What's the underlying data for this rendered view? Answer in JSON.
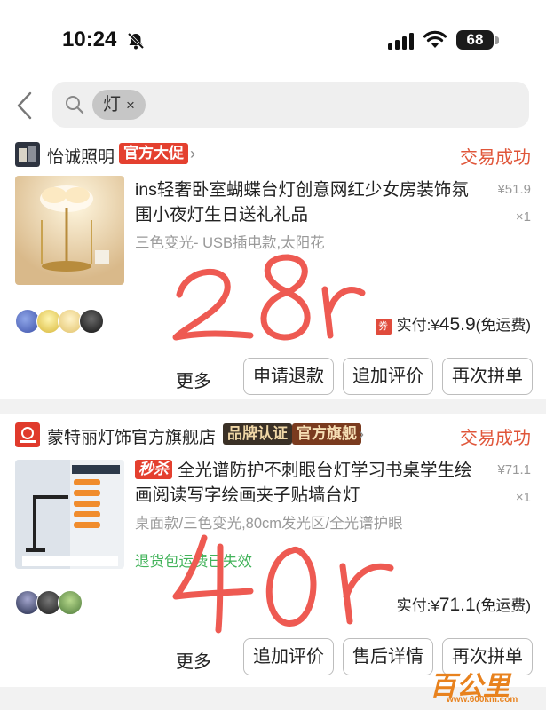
{
  "status_bar": {
    "time": "10:24",
    "battery": "68"
  },
  "search": {
    "chip": "灯",
    "chip_close": "×"
  },
  "orders": [
    {
      "shop_name": "怡诚照明",
      "badges": [
        "官方大促"
      ],
      "status": "交易成功",
      "title": "ins轻奢卧室蝴蝶台灯创意网红少女房装饰氛围小夜灯生日送礼礼品",
      "price": "¥51.9",
      "qty": "×1",
      "sku": "三色变光- USB插电款,太阳花",
      "paid_label": "实付:",
      "paid_currency": "¥",
      "paid_amount": "45.9",
      "shipping": "(免运费)",
      "coupon_icon": "券",
      "more": "更多",
      "buttons": [
        "申请退款",
        "追加评价",
        "再次拼单"
      ],
      "handwritten": "28r"
    },
    {
      "shop_name": "蒙特丽灯饰官方旗舰店",
      "badges": [
        "品牌认证",
        "官方旗舰"
      ],
      "status": "交易成功",
      "tag": "秒杀",
      "title": "全光谱防护不刺眼台灯学习书桌学生绘画阅读写字绘画夹子贴墙台灯",
      "price": "¥71.1",
      "qty": "×1",
      "sku": "桌面款/三色变光,80cm发光区/全光谱护眼",
      "return_note": "退货包运费已失效",
      "paid_label": "实付:",
      "paid_currency": "¥",
      "paid_amount": "71.1",
      "shipping": "(免运费)",
      "more": "更多",
      "buttons": [
        "追加评价",
        "售后详情",
        "再次拼单"
      ],
      "handwritten": "40r"
    }
  ],
  "watermark": {
    "text": "百公里",
    "url": "www.600km.com"
  }
}
